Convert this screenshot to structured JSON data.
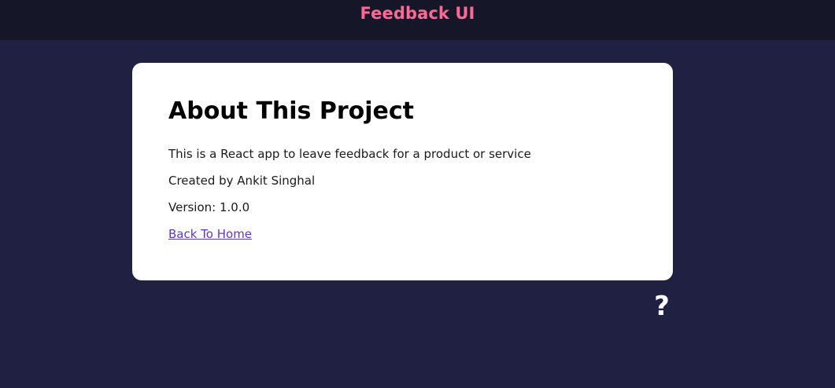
{
  "header": {
    "title": "Feedback UI"
  },
  "about": {
    "heading": "About This Project",
    "description": "This is a React app to leave feedback for a product or service",
    "author": "Created by Ankit Singhal",
    "version": "Version: 1.0.0",
    "back_link": "Back To Home"
  },
  "help": {
    "icon": "question-icon",
    "glyph": "?"
  },
  "colors": {
    "background": "#202142",
    "header_background": "#161629",
    "accent": "#ff6a95",
    "card_background": "#ffffff",
    "link": "#6238c0"
  }
}
